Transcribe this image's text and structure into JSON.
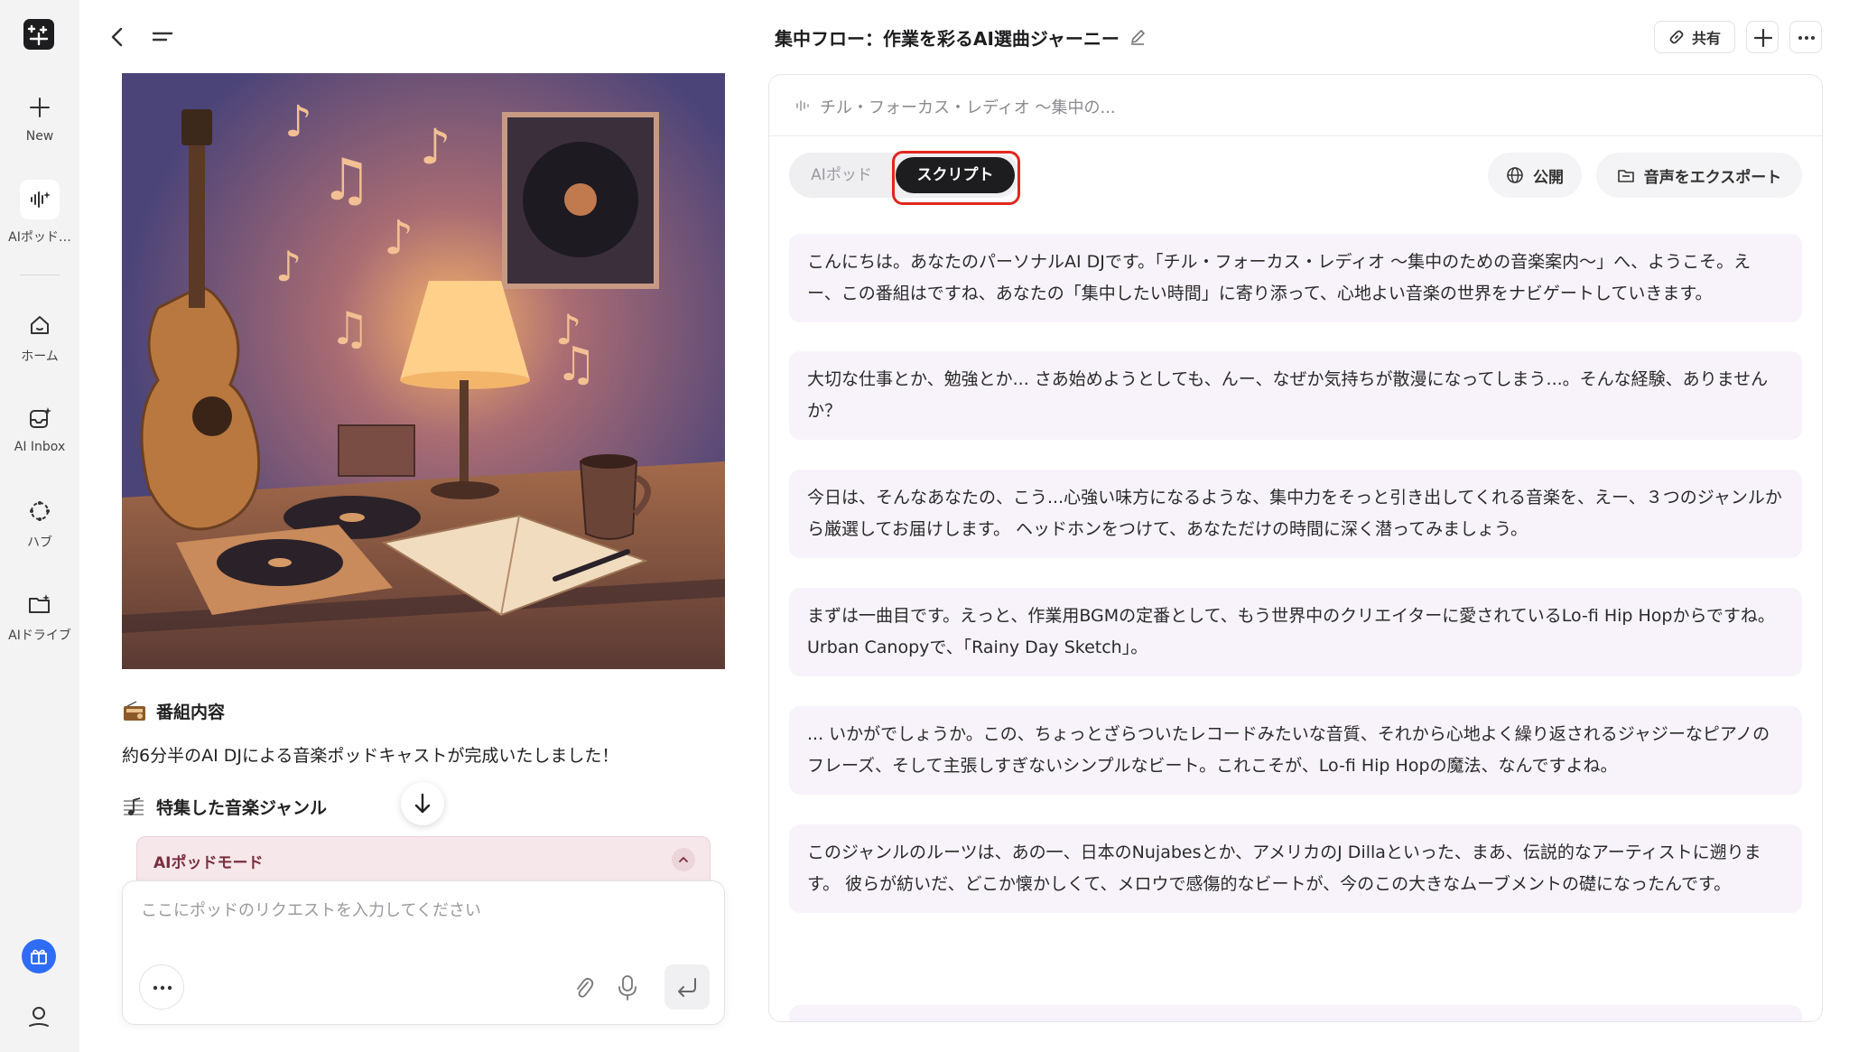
{
  "app": {
    "title": "集中フロー：作業を彩るAI選曲ジャーニー"
  },
  "rail": {
    "new_label": "New",
    "podcast_label": "AIポッド…",
    "home_label": "ホーム",
    "inbox_label": "AI Inbox",
    "hub_label": "ハブ",
    "drive_label": "AIドライブ"
  },
  "topbar": {
    "share_label": "共有"
  },
  "left": {
    "section1_title": "番組内容",
    "section1_body": "約6分半のAI DJによる音楽ポッドキャストが完成いたしました！",
    "section2_title": "特集した音楽ジャンル",
    "mode_label": "AIポッドモード",
    "composer_placeholder": "ここにポッドのリクエストを入力してください"
  },
  "panel": {
    "header": "チル・フォーカス・レディオ 〜集中の...",
    "tab_pod": "AIポッド",
    "tab_script": "スクリプト",
    "publish_label": "公開",
    "export_label": "音声をエクスポート",
    "paragraphs": [
      "こんにちは。あなたのパーソナルAI DJです。「チル・フォーカス・レディオ 〜集中のための音楽案内〜」へ、ようこそ。えー、この番組はですね、あなたの「集中したい時間」に寄り添って、心地よい音楽の世界をナビゲートしていきます。",
      "大切な仕事とか、勉強とか... さあ始めようとしても、んー、なぜか気持ちが散漫になってしまう...。そんな経験、ありませんか？",
      "今日は、そんなあなたの、こう...心強い味方になるような、集中力をそっと引き出してくれる音楽を、えー、３つのジャンルから厳選してお届けします。 ヘッドホンをつけて、あなただけの時間に深く潜ってみましょう。",
      "まずは一曲目です。えっと、作業用BGMの定番として、もう世界中のクリエイターに愛されているLo-fi Hip Hopからですね。Urban Canopyで、「Rainy Day Sketch」。",
      "... いかがでしょうか。この、ちょっとざらついたレコードみたいな音質、それから心地よく繰り返されるジャジーなピアノのフレーズ、そして主張しすぎないシンプルなビート。これこそが、Lo-fi Hip Hopの魔法、なんですよね。",
      "このジャンルのルーツは、あの一、日本のNujabesとか、アメリカのJ Dillaといった、まあ、伝説的なアーティストに遡ります。 彼らが紡いだ、どこか懐かしくて、メロウで感傷的なビートが、今のこの大きなムーブメントの礎になったんです。"
    ]
  },
  "colors": {
    "accent_red": "#e0271f",
    "script_bg": "#f8f3fb",
    "mode_bg": "#f6e7ea",
    "gift_blue": "#2f6cf6"
  }
}
